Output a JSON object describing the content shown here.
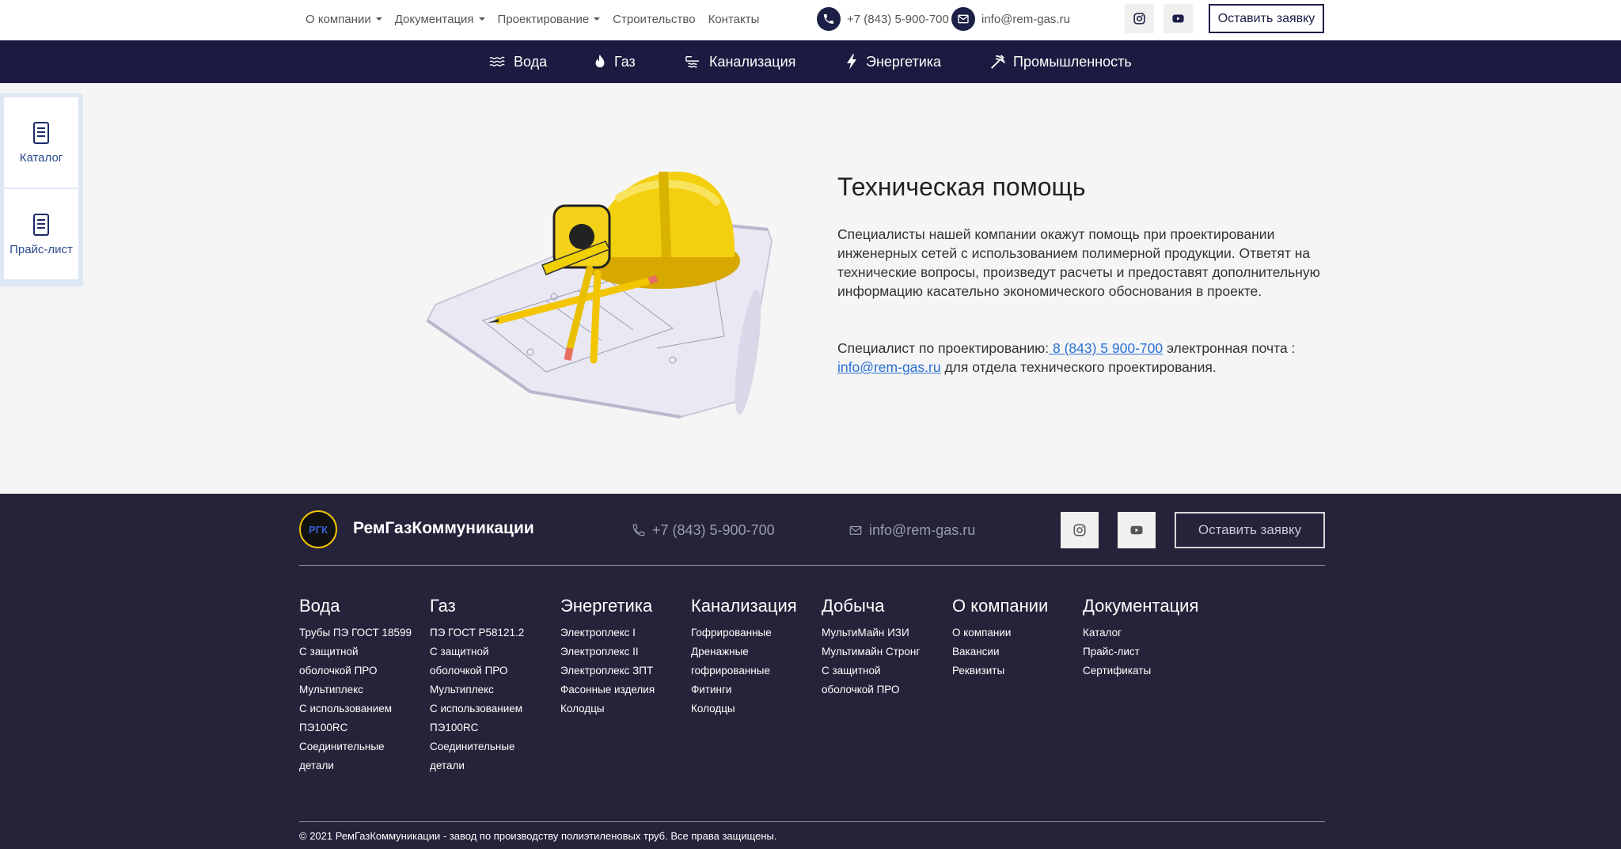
{
  "topnav": {
    "items": [
      {
        "label": "О компании",
        "dropdown": true
      },
      {
        "label": "Документация",
        "dropdown": true
      },
      {
        "label": "Проектирование",
        "dropdown": true
      },
      {
        "label": "Строительство",
        "dropdown": false
      },
      {
        "label": "Контакты",
        "dropdown": false
      }
    ],
    "phone": "+7 (843) 5-900-700",
    "email": "info@rem-gas.ru",
    "cta": "Оставить заявку",
    "social": [
      "instagram-icon",
      "youtube-icon"
    ]
  },
  "catbar": {
    "items": [
      {
        "label": "Вода",
        "icon": "water-icon"
      },
      {
        "label": "Газ",
        "icon": "flame-icon"
      },
      {
        "label": "Канализация",
        "icon": "sewer-icon"
      },
      {
        "label": "Энергетика",
        "icon": "lightning-icon"
      },
      {
        "label": "Промышленность",
        "icon": "pickaxe-icon"
      }
    ]
  },
  "side": {
    "items": [
      {
        "label": "Каталог",
        "icon": "document-icon"
      },
      {
        "label": "Прайс-лист",
        "icon": "document-icon"
      }
    ]
  },
  "hero": {
    "title": "Техническая помощь",
    "paragraph": "Специалисты нашей компании окажут помощь при проектировании инженерных сетей с использованием полимерной продукции. Ответят на технические вопросы, произведут расчеты и предоставят дополнительную информацию касательно экономического обоснования в проекте.",
    "contact_prefix": "Специалист по проектированию:",
    "contact_phone": " 8 (843) 5 900-700",
    "contact_mid": " электронная почта :",
    "contact_email": "info@rem-gas.ru",
    "contact_suffix": " для отдела технического проектирования."
  },
  "footer": {
    "logo_text": "РГК",
    "brand": "РемГазКоммуникации",
    "phone": "+7 (843) 5-900-700",
    "email": "info@rem-gas.ru",
    "cta": "Оставить заявку",
    "columns": [
      {
        "title": "Вода",
        "links": [
          "Трубы ПЭ ГОСТ 18599",
          "С защитной",
          "оболочкой ПРО",
          "Мультиплекс",
          "С использованием",
          "ПЭ100RC",
          "Соединительные",
          "детали"
        ]
      },
      {
        "title": "Газ",
        "links": [
          "ПЭ ГОСТ Р58121.2",
          "С защитной",
          "оболочкой ПРО",
          "Мультиплекс",
          "С использованием",
          "ПЭ100RC",
          "Соединительные",
          "детали"
        ]
      },
      {
        "title": "Энергетика",
        "links": [
          "Электроплекс I",
          "Электроплекс II",
          "Электроплекс ЗПТ",
          "Фасонные изделия",
          "Колодцы"
        ]
      },
      {
        "title": "Канализация",
        "links": [
          "Гофрированные",
          "Дренажные",
          "гофрированные",
          "Фитинги",
          "Колодцы"
        ]
      },
      {
        "title": "Добыча",
        "links": [
          "МультиМайн ИЗИ",
          "Мультимайн Стронг",
          "С защитной",
          "оболочкой ПРО"
        ]
      },
      {
        "title": "О компании",
        "links": [
          "О компании",
          "Вакансии",
          "Реквизиты"
        ]
      },
      {
        "title": "Документация",
        "links": [
          "Каталог",
          "Прайс-лист",
          "Сертификаты"
        ]
      }
    ],
    "copyright": "© 2021 РемГазКоммуникации - завод по производству полиэтиленовых труб. Все права защищены."
  }
}
